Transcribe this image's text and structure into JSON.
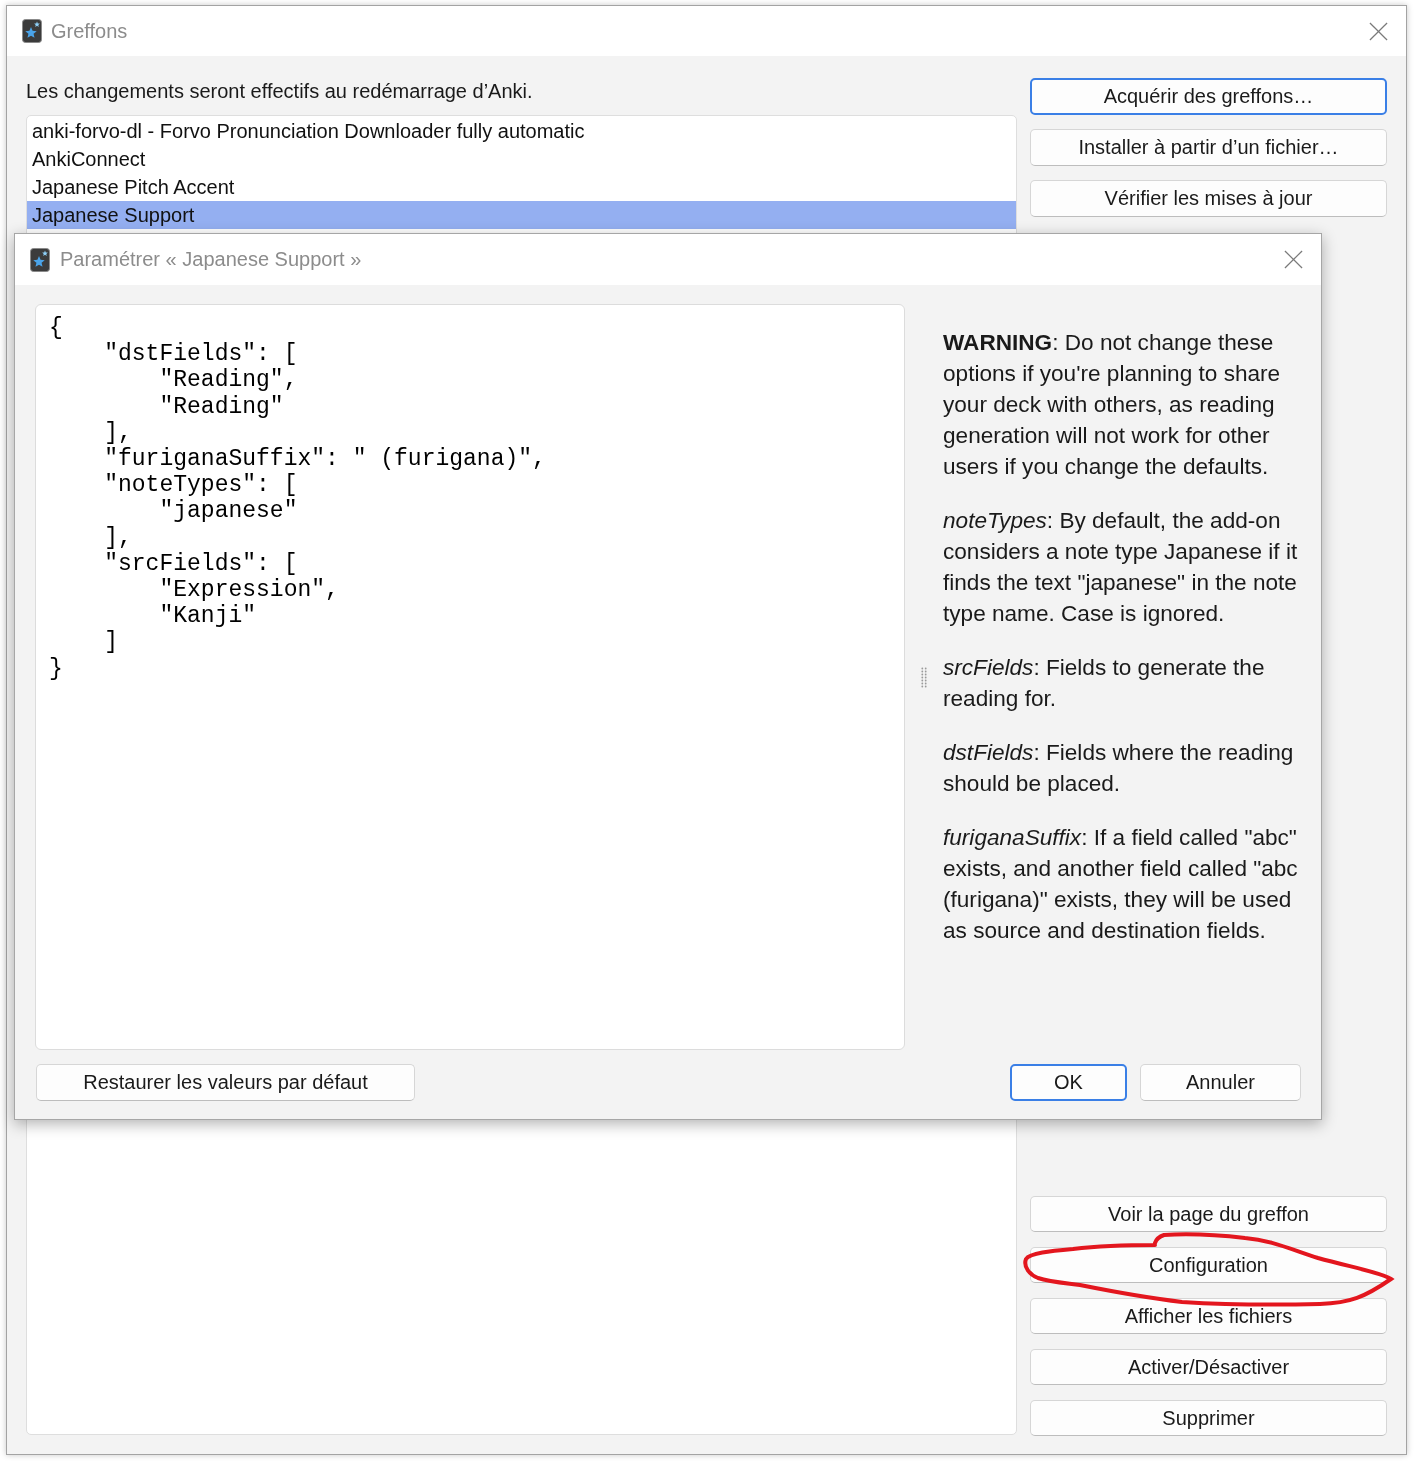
{
  "window": {
    "title": "Greffons"
  },
  "notice": "Les changements seront effectifs au redémarrage d’Anki.",
  "addons": [
    {
      "name": "anki-forvo-dl - Forvo Pronunciation Downloader fully automatic",
      "selected": false
    },
    {
      "name": "AnkiConnect",
      "selected": false
    },
    {
      "name": "Japanese Pitch Accent",
      "selected": false
    },
    {
      "name": "Japanese Support",
      "selected": true
    }
  ],
  "top_buttons": [
    {
      "label": "Acquérir des greffons…",
      "focused": true
    },
    {
      "label": "Installer à partir d’un fichier…",
      "focused": false
    },
    {
      "label": "Vérifier les mises à jour",
      "focused": false
    }
  ],
  "bottom_buttons": [
    {
      "label": "Voir la page du greffon",
      "circled": false
    },
    {
      "label": "Configuration",
      "circled": true
    },
    {
      "label": "Afficher les fichiers",
      "circled": false
    },
    {
      "label": "Activer/Désactiver",
      "circled": false
    },
    {
      "label": "Supprimer",
      "circled": false
    }
  ],
  "dialog": {
    "title": "Paramétrer « Japanese Support »",
    "config_text": "{\n    \"dstFields\": [\n        \"Reading\",\n        \"Reading\"\n    ],\n    \"furiganaSuffix\": \" (furigana)\",\n    \"noteTypes\": [\n        \"japanese\"\n    ],\n    \"srcFields\": [\n        \"Expression\",\n        \"Kanji\"\n    ]\n}",
    "help": [
      "**WARNING**: Do not change these options if you're planning to share your deck with others, as reading generation will not work for other users if you change the defaults.",
      "*noteTypes*: By default, the add-on considers a note type Japanese if it finds the text \"japanese\" in the note type name. Case is ignored.",
      "*srcFields*: Fields to generate the reading for.",
      "*dstFields*: Fields where the reading should be placed.",
      "*furiganaSuffix*: If a field called \"abc\" exists, and another field called \"abc (furigana)\" exists, they will be used as source and destination fields."
    ],
    "reset_button": {
      "label": "Restaurer les valeurs par défaut"
    },
    "buttons": [
      {
        "label": "OK",
        "default": true
      },
      {
        "label": "Annuler",
        "default": false
      }
    ]
  }
}
